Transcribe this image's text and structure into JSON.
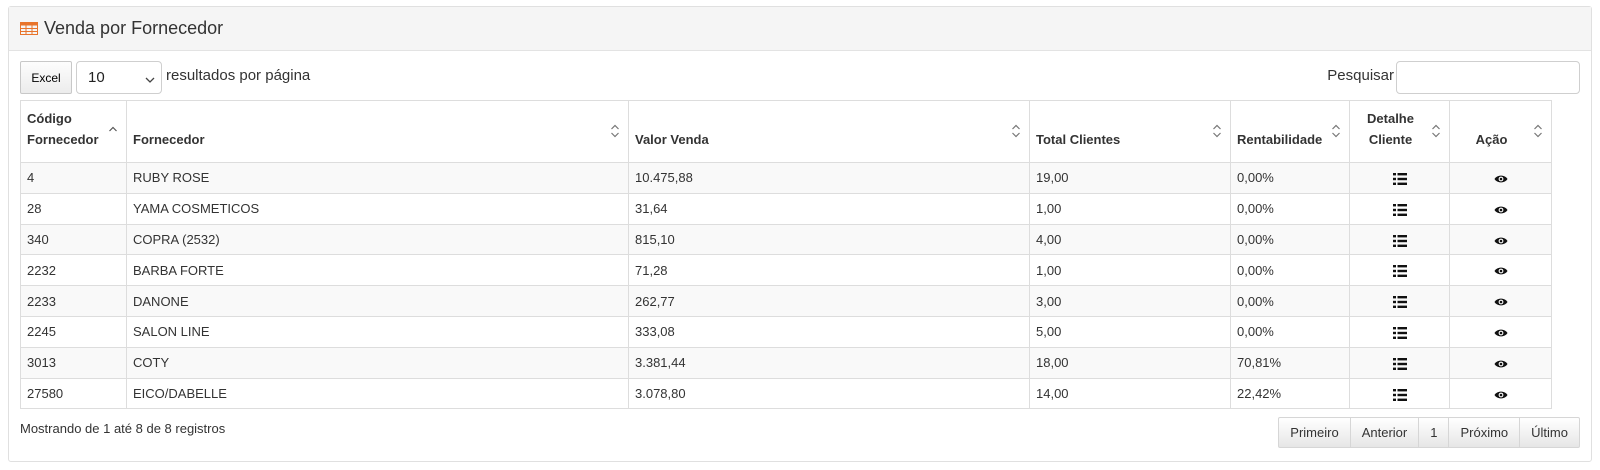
{
  "panel": {
    "title": "Venda por Fornecedor",
    "icon": "table-icon",
    "accent": "#e8742b"
  },
  "controls": {
    "excel_label": "Excel",
    "page_size_value": "10",
    "per_page_label": "resultados por página",
    "search_label": "Pesquisar",
    "search_value": ""
  },
  "table": {
    "columns": [
      {
        "line1": "Código",
        "line2": "Fornecedor",
        "sort": "asc"
      },
      {
        "line1": "",
        "line2": "Fornecedor",
        "sort": "both"
      },
      {
        "line1": "",
        "line2": "Valor Venda",
        "sort": "both"
      },
      {
        "line1": "",
        "line2": "Total Clientes",
        "sort": "both"
      },
      {
        "line1": "",
        "line2": "Rentabilidade",
        "sort": "both"
      },
      {
        "line1": "Detalhe",
        "line2": "Cliente",
        "sort": "both"
      },
      {
        "line1": "",
        "line2": "Ação",
        "sort": "both"
      }
    ],
    "rows": [
      {
        "codigo": "4",
        "fornecedor": "RUBY ROSE",
        "valor_venda": "10.475,88",
        "total_clientes": "19,00",
        "rentabilidade": "0,00%"
      },
      {
        "codigo": "28",
        "fornecedor": "YAMA COSMETICOS",
        "valor_venda": "31,64",
        "total_clientes": "1,00",
        "rentabilidade": "0,00%"
      },
      {
        "codigo": "340",
        "fornecedor": "COPRA (2532)",
        "valor_venda": "815,10",
        "total_clientes": "4,00",
        "rentabilidade": "0,00%"
      },
      {
        "codigo": "2232",
        "fornecedor": "BARBA FORTE",
        "valor_venda": "71,28",
        "total_clientes": "1,00",
        "rentabilidade": "0,00%"
      },
      {
        "codigo": "2233",
        "fornecedor": "DANONE",
        "valor_venda": "262,77",
        "total_clientes": "3,00",
        "rentabilidade": "0,00%"
      },
      {
        "codigo": "2245",
        "fornecedor": "SALON LINE",
        "valor_venda": "333,08",
        "total_clientes": "5,00",
        "rentabilidade": "0,00%"
      },
      {
        "codigo": "3013",
        "fornecedor": "COTY",
        "valor_venda": "3.381,44",
        "total_clientes": "18,00",
        "rentabilidade": "70,81%"
      },
      {
        "codigo": "27580",
        "fornecedor": "EICO/DABELLE",
        "valor_venda": "3.078,80",
        "total_clientes": "14,00",
        "rentabilidade": "22,42%"
      }
    ],
    "row_icons": {
      "detail": "list-icon",
      "action": "eye-icon"
    }
  },
  "footer": {
    "info": "Mostrando de 1 até 8 de 8 registros",
    "pager": [
      "Primeiro",
      "Anterior",
      "1",
      "Próximo",
      "Último"
    ]
  }
}
